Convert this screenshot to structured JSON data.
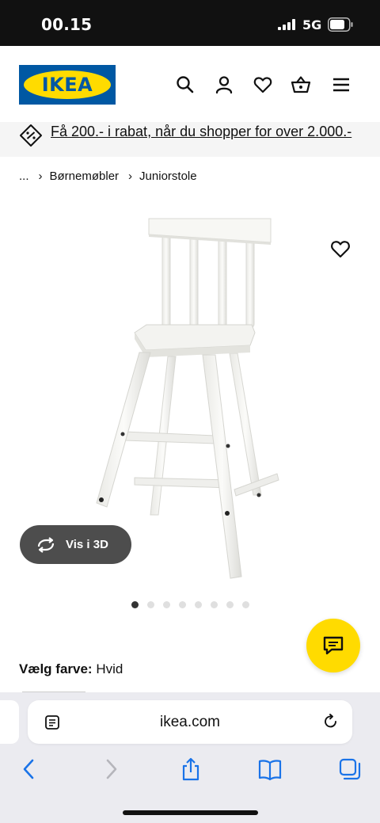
{
  "status": {
    "time": "00.15",
    "network": "5G"
  },
  "brand": {
    "logo_text": "IKEA",
    "yellow": "#ffdb00",
    "blue": "#0058a3"
  },
  "header": {
    "icons": [
      "search-icon",
      "account-icon",
      "favorites-icon",
      "basket-icon",
      "menu-icon"
    ]
  },
  "promo": {
    "text": "Få 200.- i rabat, når du shopper for over 2.000.-",
    "icon": "discount-tag-icon"
  },
  "breadcrumb": {
    "ellipsis": "...",
    "items": [
      "Børnemøbler",
      "Juniorstole"
    ]
  },
  "product": {
    "view3d_label": "Vis i 3D",
    "image_count": 8,
    "active_image": 1,
    "color_label": "Vælg farve:",
    "color_value": "Hvid"
  },
  "browser": {
    "url": "ikea.com"
  }
}
